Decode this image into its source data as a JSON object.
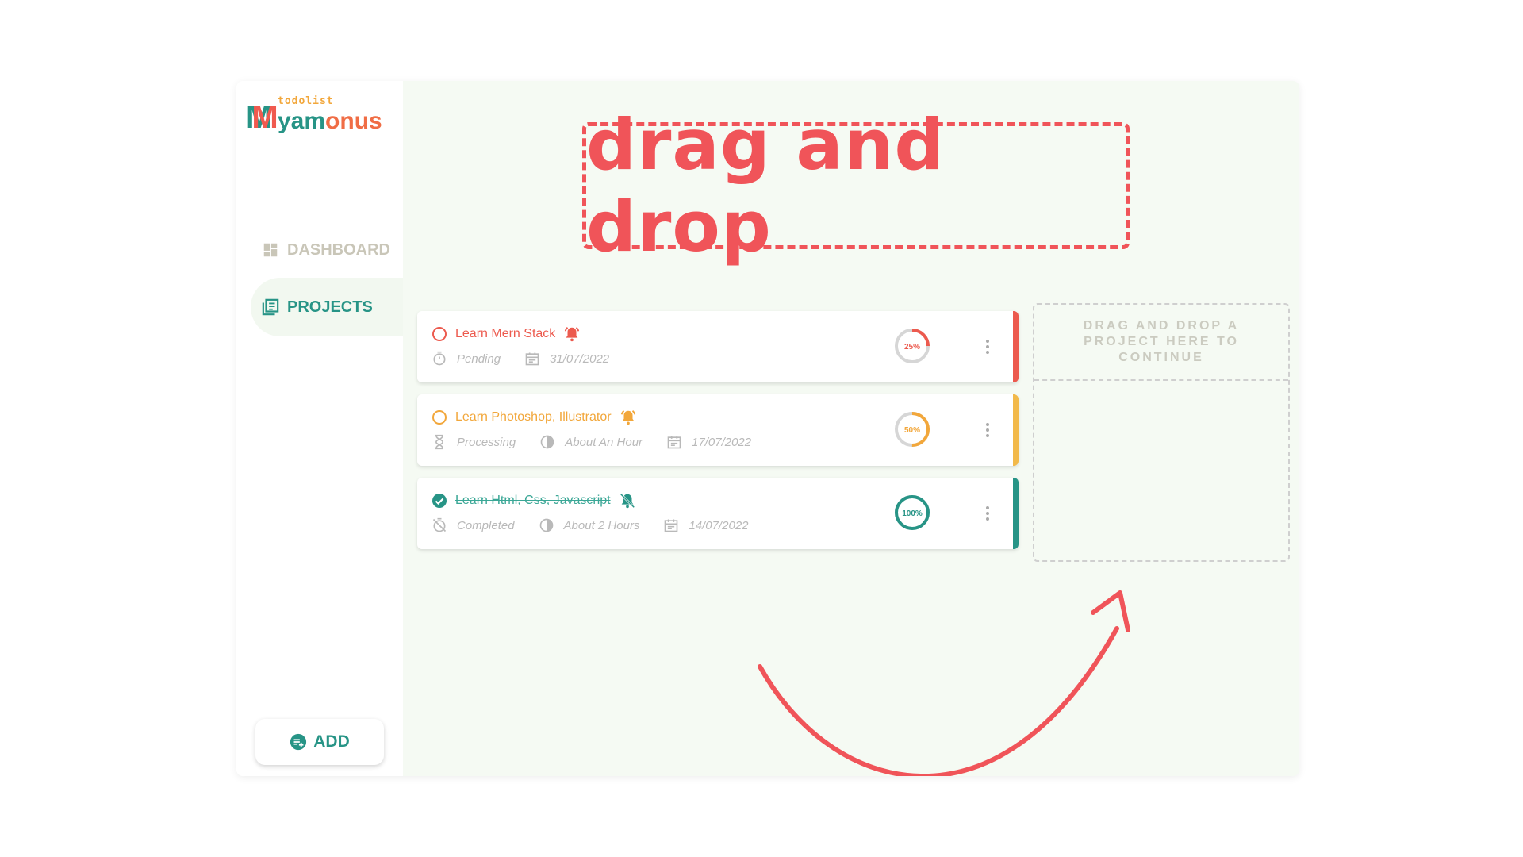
{
  "logo": {
    "small": "todolist",
    "big_a": "yam",
    "big_b": "onus"
  },
  "nav": {
    "dashboard": "DASHBOARD",
    "projects": "PROJECTS"
  },
  "add_button": "ADD",
  "banner": "drag and drop",
  "tasks": [
    {
      "title": "Learn Mern Stack",
      "status": "Pending",
      "duration": "",
      "date": "31/07/2022",
      "progress": 25,
      "progress_label": "25%",
      "color": "#ec5a4e",
      "bell": "bell-active"
    },
    {
      "title": "Learn Photoshop, Illustrator",
      "status": "Processing",
      "duration": "About An Hour",
      "date": "17/07/2022",
      "progress": 50,
      "progress_label": "50%",
      "color": "#f2a73b",
      "bell": "bell-active"
    },
    {
      "title": "Learn Html, Css, Javascript",
      "status": "Completed",
      "duration": "About 2 Hours",
      "date": "14/07/2022",
      "progress": 100,
      "progress_label": "100%",
      "color": "#279486",
      "bell": "bell-off"
    }
  ],
  "dropzone": "DRAG AND DROP A PROJECT HERE TO CONTINUE",
  "colors": {
    "brand": "#279486",
    "accent": "#f05459",
    "pending": "#ec5a4e",
    "processing": "#f2a73b",
    "completed": "#279486"
  }
}
